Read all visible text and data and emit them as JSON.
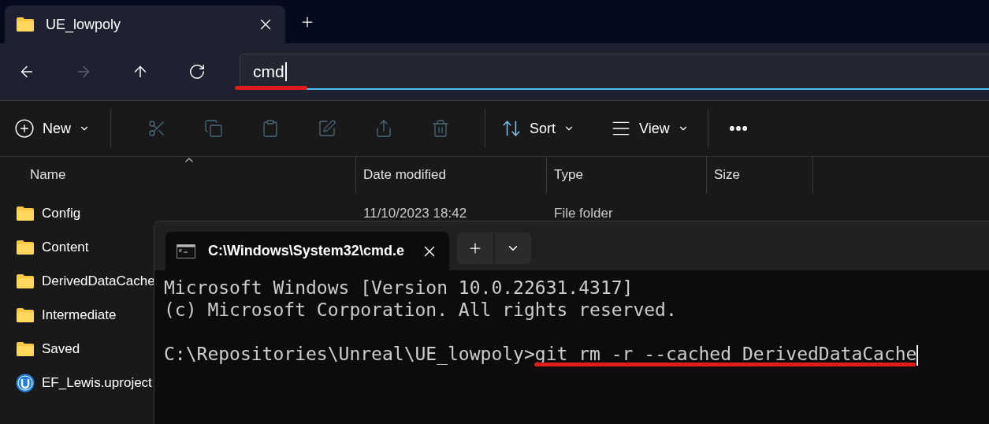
{
  "explorer_tab": {
    "title": "UE_lowpoly"
  },
  "navigation": [
    {
      "kind": "back",
      "disabled": false
    },
    {
      "kind": "forward",
      "disabled": true
    },
    {
      "kind": "up",
      "disabled": false
    },
    {
      "kind": "refresh",
      "disabled": false
    }
  ],
  "address_bar": {
    "value": "cmd"
  },
  "command_bar": {
    "new": "New",
    "tools": [
      {
        "kind": "cut",
        "disabled": true
      },
      {
        "kind": "copy",
        "disabled": true
      },
      {
        "kind": "paste",
        "disabled": true
      },
      {
        "kind": "rename",
        "disabled": true
      },
      {
        "kind": "share",
        "disabled": true
      },
      {
        "kind": "delete",
        "disabled": true
      }
    ],
    "sort": "Sort",
    "view": "View"
  },
  "columns": [
    {
      "label": "Name",
      "sorted": true
    },
    {
      "label": "Date modified",
      "sorted": false
    },
    {
      "label": "Type",
      "sorted": false
    },
    {
      "label": "Size",
      "sorted": false
    }
  ],
  "files": [
    {
      "kind": "folder",
      "name": "Config",
      "date": "11/10/2023 18:42",
      "type": "File folder"
    },
    {
      "kind": "folder",
      "name": "Content"
    },
    {
      "kind": "folder",
      "name": "DerivedDataCache"
    },
    {
      "kind": "folder",
      "name": "Intermediate"
    },
    {
      "kind": "folder",
      "name": "Saved"
    },
    {
      "kind": "project",
      "name": "EF_Lewis.uproject"
    }
  ],
  "terminal": {
    "tab_title": "C:\\Windows\\System32\\cmd.e",
    "lines": [
      "Microsoft Windows [Version 10.0.22631.4317]",
      "(c) Microsoft Corporation. All rights reserved."
    ],
    "prompt": "C:\\Repositories\\Unreal\\UE_lowpoly>",
    "command": "git rm -r --cached DerivedDataCache"
  }
}
